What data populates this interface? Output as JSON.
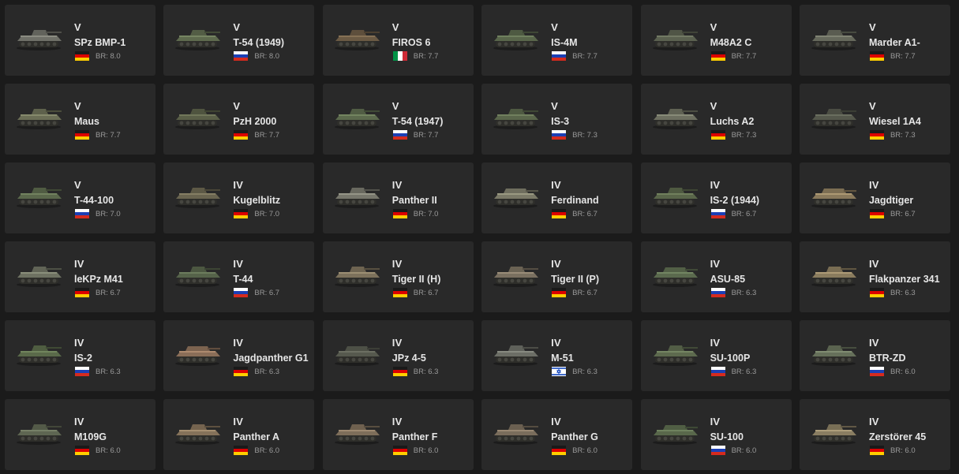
{
  "br_prefix": "BR: ",
  "vehicles": [
    {
      "tier": "V",
      "name": "SPz BMP-1",
      "nation": "germany",
      "br": "8.0",
      "hull_color": "#6f7068",
      "has_turret": true
    },
    {
      "tier": "V",
      "name": "T-54 (1949)",
      "nation": "ussr",
      "br": "8.0",
      "hull_color": "#5e6a4e",
      "has_turret": true
    },
    {
      "tier": "V",
      "name": "FIROS 6",
      "nation": "italy",
      "br": "7.7",
      "hull_color": "#6b5a44",
      "has_turret": true
    },
    {
      "tier": "V",
      "name": "IS-4M",
      "nation": "ussr",
      "br": "7.7",
      "hull_color": "#59664b",
      "has_turret": true
    },
    {
      "tier": "V",
      "name": "M48A2 C",
      "nation": "germany",
      "br": "7.7",
      "hull_color": "#5b6150",
      "has_turret": true
    },
    {
      "tier": "V",
      "name": "Marder A1-",
      "nation": "germany",
      "br": "7.7",
      "hull_color": "#66695c",
      "has_turret": true
    },
    {
      "tier": "V",
      "name": "Maus",
      "nation": "germany",
      "br": "7.7",
      "hull_color": "#6b6e56",
      "has_turret": true
    },
    {
      "tier": "V",
      "name": "PzH 2000",
      "nation": "germany",
      "br": "7.7",
      "hull_color": "#5a5f48",
      "has_turret": true
    },
    {
      "tier": "V",
      "name": "T-54 (1947)",
      "nation": "ussr",
      "br": "7.7",
      "hull_color": "#5c6a4d",
      "has_turret": true
    },
    {
      "tier": "V",
      "name": "IS-3",
      "nation": "ussr",
      "br": "7.3",
      "hull_color": "#5a664b",
      "has_turret": true
    },
    {
      "tier": "V",
      "name": "Luchs A2",
      "nation": "germany",
      "br": "7.3",
      "hull_color": "#6d6f60",
      "has_turret": true
    },
    {
      "tier": "V",
      "name": "Wiesel 1A4",
      "nation": "germany",
      "br": "7.3",
      "hull_color": "#55584c",
      "has_turret": true
    },
    {
      "tier": "V",
      "name": "T-44-100",
      "nation": "ussr",
      "br": "7.0",
      "hull_color": "#5b684c",
      "has_turret": true
    },
    {
      "tier": "IV",
      "name": "Kugelblitz",
      "nation": "germany",
      "br": "7.0",
      "hull_color": "#6a6550",
      "has_turret": true
    },
    {
      "tier": "IV",
      "name": "Panther II",
      "nation": "germany",
      "br": "7.0",
      "hull_color": "#77776c",
      "has_turret": true
    },
    {
      "tier": "IV",
      "name": "Ferdinand",
      "nation": "germany",
      "br": "6.7",
      "hull_color": "#7b7a68",
      "has_turret": false
    },
    {
      "tier": "IV",
      "name": "IS-2 (1944)",
      "nation": "ussr",
      "br": "6.7",
      "hull_color": "#5a664a",
      "has_turret": true
    },
    {
      "tier": "IV",
      "name": "Jagdtiger",
      "nation": "germany",
      "br": "6.7",
      "hull_color": "#8a7a5c",
      "has_turret": false
    },
    {
      "tier": "IV",
      "name": "leKPz M41",
      "nation": "germany",
      "br": "6.7",
      "hull_color": "#6e7262",
      "has_turret": true
    },
    {
      "tier": "IV",
      "name": "T-44",
      "nation": "ussr",
      "br": "6.7",
      "hull_color": "#56634a",
      "has_turret": true
    },
    {
      "tier": "IV",
      "name": "Tiger II (H)",
      "nation": "germany",
      "br": "6.7",
      "hull_color": "#7d725c",
      "has_turret": true
    },
    {
      "tier": "IV",
      "name": "Tiger II (P)",
      "nation": "germany",
      "br": "6.7",
      "hull_color": "#7a7060",
      "has_turret": true
    },
    {
      "tier": "IV",
      "name": "ASU-85",
      "nation": "ussr",
      "br": "6.3",
      "hull_color": "#5b6a4e",
      "has_turret": false
    },
    {
      "tier": "IV",
      "name": "Flakpanzer 341",
      "nation": "germany",
      "br": "6.3",
      "hull_color": "#8a7c5e",
      "has_turret": true
    },
    {
      "tier": "IV",
      "name": "IS-2",
      "nation": "ussr",
      "br": "6.3",
      "hull_color": "#5a6a4a",
      "has_turret": true
    },
    {
      "tier": "IV",
      "name": "Jagdpanther G1",
      "nation": "germany",
      "br": "6.3",
      "hull_color": "#8a6e58",
      "has_turret": false
    },
    {
      "tier": "IV",
      "name": "JPz 4-5",
      "nation": "germany",
      "br": "6.3",
      "hull_color": "#56594e",
      "has_turret": false
    },
    {
      "tier": "IV",
      "name": "M-51",
      "nation": "israel",
      "br": "6.3",
      "hull_color": "#6c6e66",
      "has_turret": true
    },
    {
      "tier": "IV",
      "name": "SU-100P",
      "nation": "ussr",
      "br": "6.3",
      "hull_color": "#5d6a4e",
      "has_turret": true
    },
    {
      "tier": "IV",
      "name": "BTR-ZD",
      "nation": "ussr",
      "br": "6.0",
      "hull_color": "#66705a",
      "has_turret": true
    },
    {
      "tier": "IV",
      "name": "M109G",
      "nation": "germany",
      "br": "6.0",
      "hull_color": "#5e6652",
      "has_turret": true
    },
    {
      "tier": "IV",
      "name": "Panther A",
      "nation": "germany",
      "br": "6.0",
      "hull_color": "#85725a",
      "has_turret": true
    },
    {
      "tier": "IV",
      "name": "Panther F",
      "nation": "germany",
      "br": "6.0",
      "hull_color": "#7e6e5a",
      "has_turret": true
    },
    {
      "tier": "IV",
      "name": "Panther G",
      "nation": "germany",
      "br": "6.0",
      "hull_color": "#7a6d5c",
      "has_turret": true
    },
    {
      "tier": "IV",
      "name": "SU-100",
      "nation": "ussr",
      "br": "6.0",
      "hull_color": "#59684b",
      "has_turret": false
    },
    {
      "tier": "IV",
      "name": "Zerstörer 45",
      "nation": "germany",
      "br": "6.0",
      "hull_color": "#8a7e62",
      "has_turret": true
    }
  ],
  "flags": {
    "germany": {
      "icon": "germany-flag-icon",
      "stripes": [
        "#1a1a1a",
        "#dd0000",
        "#ffce00"
      ],
      "orientation": "horizontal"
    },
    "ussr": {
      "icon": "russia-flag-icon",
      "stripes": [
        "#ffffff",
        "#1c3fb5",
        "#d52b1e"
      ],
      "orientation": "horizontal"
    },
    "italy": {
      "icon": "italy-flag-icon",
      "stripes": [
        "#009246",
        "#ffffff",
        "#ce2b37"
      ],
      "orientation": "vertical"
    },
    "israel": {
      "icon": "israel-flag-icon",
      "stripes": [
        "#ffffff",
        "#0038b8"
      ],
      "orientation": "israel"
    }
  }
}
